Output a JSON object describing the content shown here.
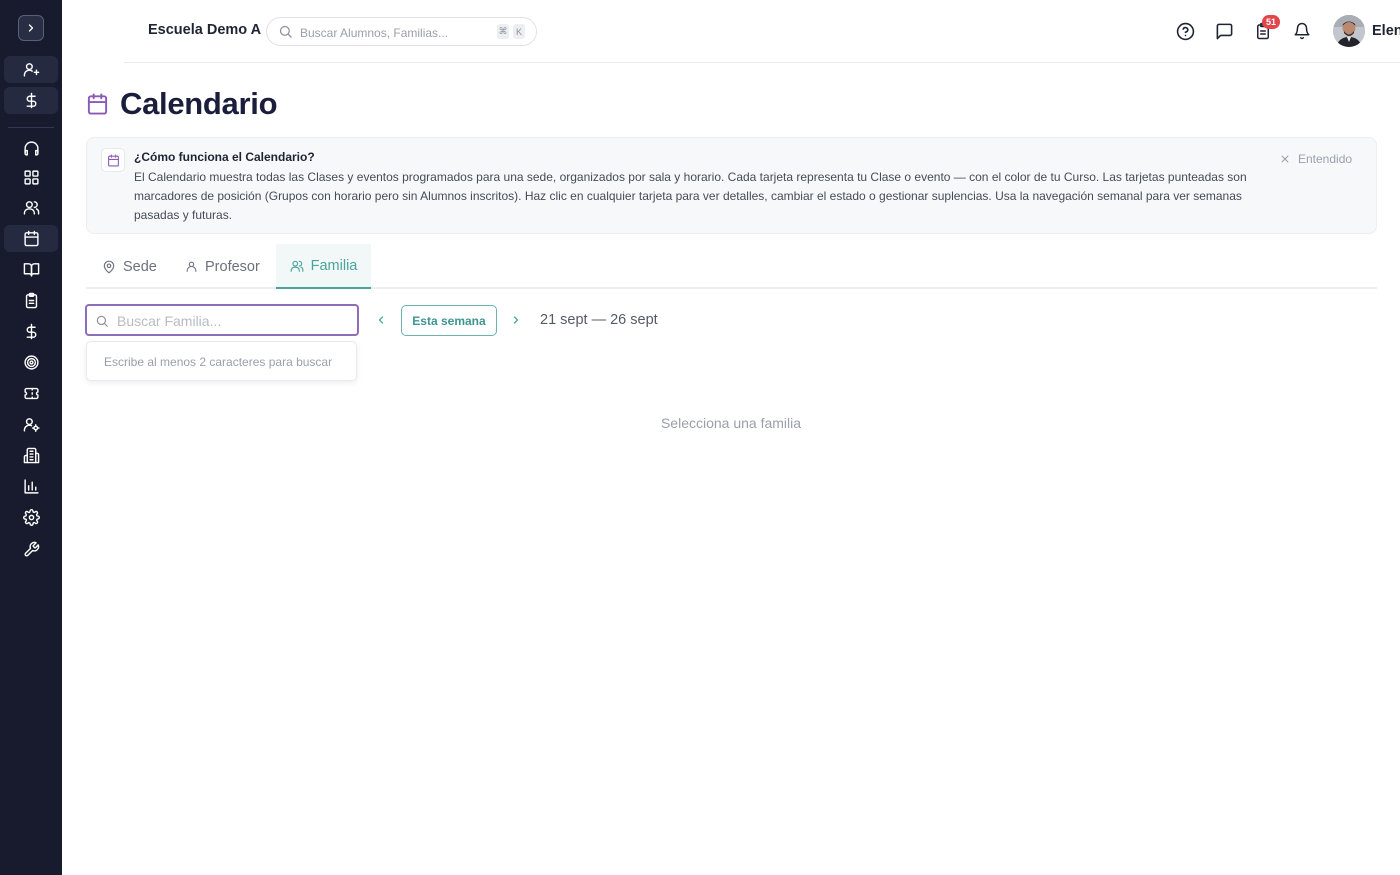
{
  "app": {
    "school_name": "Escuela Demo A",
    "global_search_placeholder": "Buscar Alumnos, Familias...",
    "shortcut_keys": [
      "⌘",
      "K"
    ],
    "notification_count": "51",
    "user_name": "Elena"
  },
  "sidebar": {
    "items": [
      {
        "icon": "user-plus-icon"
      },
      {
        "icon": "dollar-icon"
      },
      {
        "icon": "headset-icon"
      },
      {
        "icon": "dashboard-grid-icon"
      },
      {
        "icon": "users-icon"
      },
      {
        "icon": "calendar-icon",
        "active": true
      },
      {
        "icon": "book-open-icon"
      },
      {
        "icon": "clipboard-icon"
      },
      {
        "icon": "dollar-icon"
      },
      {
        "icon": "target-icon"
      },
      {
        "icon": "ticket-icon"
      },
      {
        "icon": "user-settings-icon"
      },
      {
        "icon": "building-icon"
      },
      {
        "icon": "bar-chart-icon"
      },
      {
        "icon": "gear-icon"
      },
      {
        "icon": "wrench-icon"
      }
    ]
  },
  "page": {
    "title": "Calendario"
  },
  "info": {
    "title": "¿Cómo funciona el Calendario?",
    "body": "El Calendario muestra todas las Clases y eventos programados para una sede, organizados por sala y horario. Cada tarjeta representa tu Clase o evento — con el color de tu Curso. Las tarjetas punteadas son marcadores de posición (Grupos con horario pero sin Alumnos inscritos). Haz clic en cualquier tarjeta para ver detalles, cambiar el estado o gestionar suplencias. Usa la navegación semanal para ver semanas pasadas y futuras.",
    "dismiss_label": "Entendido"
  },
  "tabs": [
    {
      "label": "Sede",
      "icon": "map-pin-icon"
    },
    {
      "label": "Profesor",
      "icon": "user-icon"
    },
    {
      "label": "Familia",
      "icon": "users-icon",
      "active": true
    }
  ],
  "toolbar": {
    "search_placeholder": "Buscar Familia...",
    "this_week_label": "Esta semana",
    "date_range": "21 sept — 26 sept"
  },
  "dropdown": {
    "hint": "Escribe al menos 2 caracteres para buscar"
  },
  "empty_state": "Selecciona una familia",
  "colors": {
    "sidebar_bg": "#181b2e",
    "accent_teal": "#4aa39e",
    "focus_purple": "#8b6fb8",
    "page_icon_purple": "#8b5ab8",
    "badge_red": "#e0464a"
  }
}
